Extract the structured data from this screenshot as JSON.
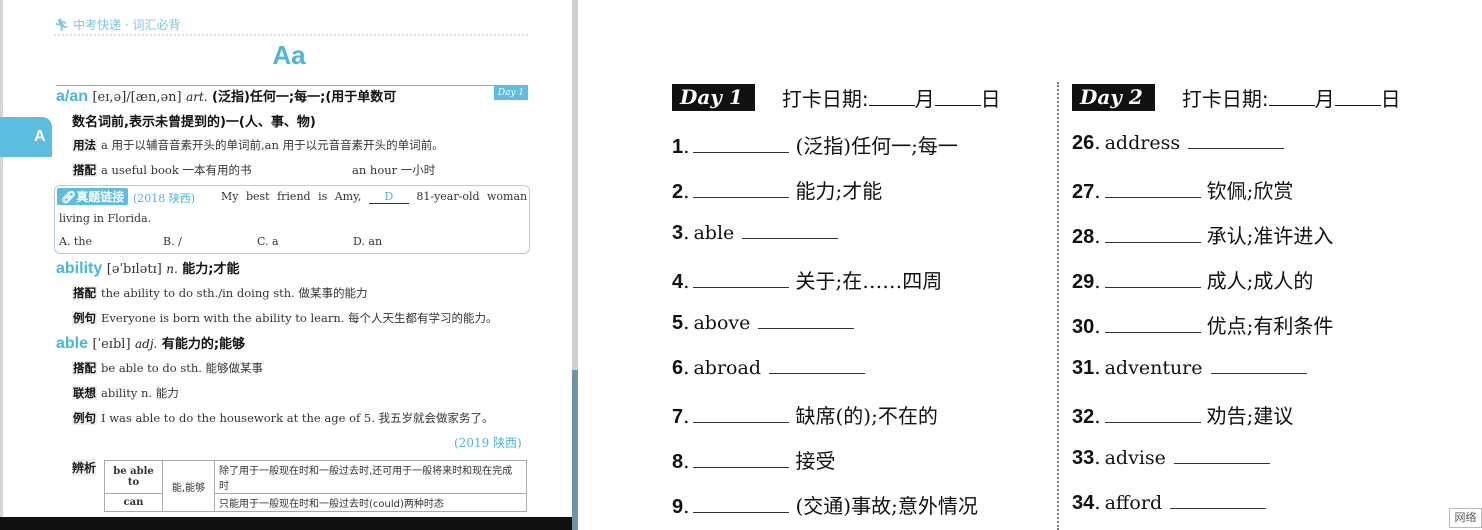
{
  "left_page": {
    "running_head": "中考快递 · 词汇必背",
    "letter_title": "Aa",
    "side_tab": "A",
    "day_badge": "Day 1",
    "entries": [
      {
        "headword": "a/an",
        "phonetic": "[eɪ,ə]/[æn,ən]",
        "pos": "art.",
        "meaning": "(泛指)任何一;每一;(用于单数可",
        "meaning_cont": "数名词前,表示未曾提到的)一(人、事、物)",
        "usage_label": "用法",
        "usage": "a 用于以辅音音素开头的单词前,an 用于以元音音素开头的单词前。",
        "collocation_label": "搭配",
        "collocation_1": "a useful book 一本有用的书",
        "collocation_2": "an hour 一小时"
      },
      {
        "headword": "ability",
        "phonetic": "[əˈbɪlətɪ]",
        "pos": "n.",
        "meaning": "能力;才能",
        "collocation_label": "搭配",
        "collocation": "the ability to do sth./in doing sth. 做某事的能力",
        "example_label": "例句",
        "example": "Everyone is born with the ability to learn. 每个人天生都有学习的能力。"
      },
      {
        "headword": "able",
        "phonetic": "[ˈeɪbl]",
        "pos": "adj.",
        "meaning": "有能力的;能够",
        "collocation_label": "搭配",
        "collocation": "be able to do sth. 能够做某事",
        "association_label": "联想",
        "association": "ability n. 能力",
        "example_label": "例句",
        "example": "I was able to do the housework at the age of 5. 我五岁就会做家务了。",
        "example_source": "(2019 陕西)"
      }
    ],
    "exam_link": {
      "label": "真题链接",
      "source": "(2018 陕西)",
      "question_part1": "My best friend is Amy,",
      "answer": "D",
      "question_part2": "81-year-old woman",
      "question_line2": "living in Florida.",
      "options": [
        "A. the",
        "B. /",
        "C. a",
        "D. an"
      ]
    },
    "distinction": {
      "label": "辨析",
      "rows": [
        {
          "term": "be able to",
          "shared_meaning": "能,能够",
          "note": "除了用于一般现在时和一般过去时,还可用于一般将来时和现在完成时"
        },
        {
          "term": "can",
          "note": "只能用于一般现在时和一般过去时(could)两种时态"
        }
      ]
    }
  },
  "right_page": {
    "columns": [
      {
        "day_label": "Day 1",
        "checkin_label": "打卡日期:",
        "month_label": "月",
        "day_unit_label": "日",
        "items": [
          {
            "num": "1",
            "word": "",
            "meaning": "(泛指)任何一;每一"
          },
          {
            "num": "2",
            "word": "",
            "meaning": "能力;才能"
          },
          {
            "num": "3",
            "word": "able",
            "meaning": ""
          },
          {
            "num": "4",
            "word": "",
            "meaning": "关于;在……四周"
          },
          {
            "num": "5",
            "word": "above",
            "meaning": ""
          },
          {
            "num": "6",
            "word": "abroad",
            "meaning": ""
          },
          {
            "num": "7",
            "word": "",
            "meaning": "缺席(的);不在的"
          },
          {
            "num": "8",
            "word": "",
            "meaning": "接受"
          },
          {
            "num": "9",
            "word": "",
            "meaning": "(交通)事故;意外情况"
          }
        ]
      },
      {
        "day_label": "Day 2",
        "checkin_label": "打卡日期:",
        "month_label": "月",
        "day_unit_label": "日",
        "items": [
          {
            "num": "26",
            "word": "address",
            "meaning": ""
          },
          {
            "num": "27",
            "word": "",
            "meaning": "钦佩;欣赏"
          },
          {
            "num": "28",
            "word": "",
            "meaning": "承认;准许进入"
          },
          {
            "num": "29",
            "word": "",
            "meaning": "成人;成人的"
          },
          {
            "num": "30",
            "word": "",
            "meaning": "优点;有利条件"
          },
          {
            "num": "31",
            "word": "adventure",
            "meaning": ""
          },
          {
            "num": "32",
            "word": "",
            "meaning": "劝告;建议"
          },
          {
            "num": "33",
            "word": "advise",
            "meaning": ""
          },
          {
            "num": "34",
            "word": "afford",
            "meaning": ""
          }
        ]
      }
    ]
  },
  "overlay": {
    "network_label": "网络"
  },
  "colors": {
    "accent": "#4ab7d6",
    "tab": "#5bbde0",
    "badge_bg": "#111111"
  }
}
